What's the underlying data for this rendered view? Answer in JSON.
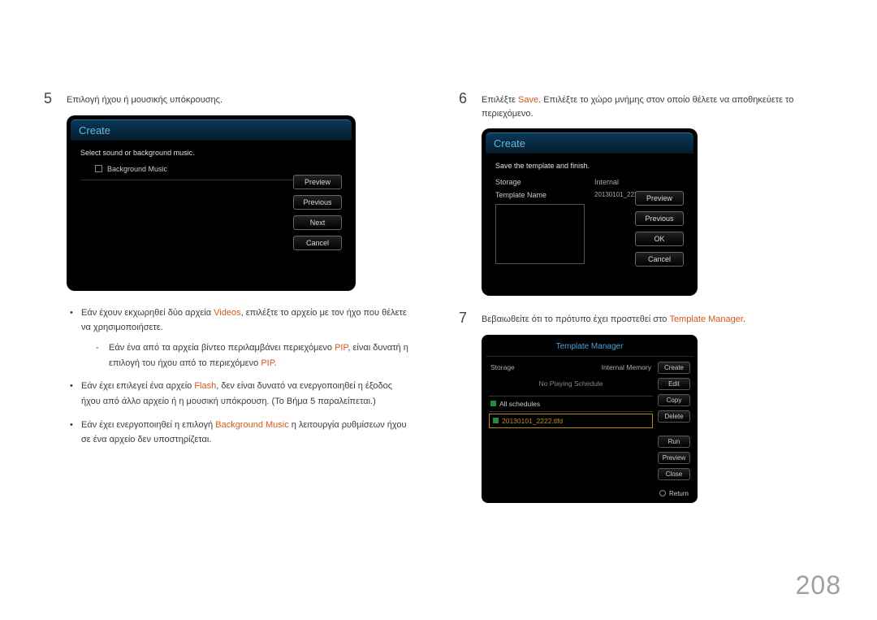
{
  "page_number": "208",
  "left": {
    "step5_num": "5",
    "step5_text": "Επιλογή ήχου ή μουσικής υπόκρουσης.",
    "panelA": {
      "title": "Create",
      "subtitle": "Select sound or background music.",
      "checkbox_label": "Background Music",
      "buttons": {
        "preview": "Preview",
        "previous": "Previous",
        "next": "Next",
        "cancel": "Cancel"
      }
    },
    "b1a": "Εάν έχουν εκχωρηθεί δύο αρχεία ",
    "b1_hl": "Videos",
    "b1b": ", επιλέξτε το αρχείο με τον ήχο που θέλετε να χρησιμοποιήσετε.",
    "b1_sub_a": "Εάν ένα από τα αρχεία βίντεο περιλαμβάνει περιεχόμενο ",
    "b1_sub_hl1": "PIP",
    "b1_sub_b": ", είναι δυνατή η επιλογή του ήχου από το περιεχόμενο ",
    "b1_sub_hl2": "PIP",
    "b1_sub_c": ".",
    "b2a": "Εάν έχει επιλεγεί ένα αρχείο ",
    "b2_hl": "Flash",
    "b2b": ", δεν είναι δυνατό να ενεργοποιηθεί η έξοδος ήχου από άλλο αρχείο ή η μουσική υπόκρουση. (Το Βήμα 5 παραλείπεται.)",
    "b3a": "Εάν έχει ενεργοποιηθεί η επιλογή ",
    "b3_hl": "Background Music",
    "b3b": " η λειτουργία ρυθμίσεων ήχου σε ένα αρχείο δεν υποστηρίζεται."
  },
  "right": {
    "step6_num": "6",
    "step6_a": "Επιλέξτε ",
    "step6_hl": "Save",
    "step6_b": ". Επιλέξτε το χώρο μνήμης στον οποίο θέλετε να αποθηκεύετε το περιεχόμενο.",
    "panelB": {
      "title": "Create",
      "subtitle": "Save the template and finish.",
      "storage_label": "Storage",
      "storage_value": "Internal",
      "tname_label": "Template Name",
      "tname_value": "20130101_2222",
      "buttons": {
        "preview": "Preview",
        "previous": "Previous",
        "ok": "OK",
        "cancel": "Cancel"
      }
    },
    "step7_num": "7",
    "step7_a": "Βεβαιωθείτε ότι το πρότυπο έχει προστεθεί στο ",
    "step7_hl": "Template Manager",
    "step7_b": ".",
    "tm": {
      "title": "Template Manager",
      "storage_label": "Storage",
      "storage_value": "Internal Memory",
      "noplaying": "No Playing Schedule",
      "all_schedules": "All schedules",
      "file": "20130101_2222.tlfd",
      "buttons": {
        "create": "Create",
        "edit": "Edit",
        "copy": "Copy",
        "delete": "Delete",
        "run": "Run",
        "preview": "Preview",
        "close": "Close"
      },
      "return": "Return"
    }
  }
}
